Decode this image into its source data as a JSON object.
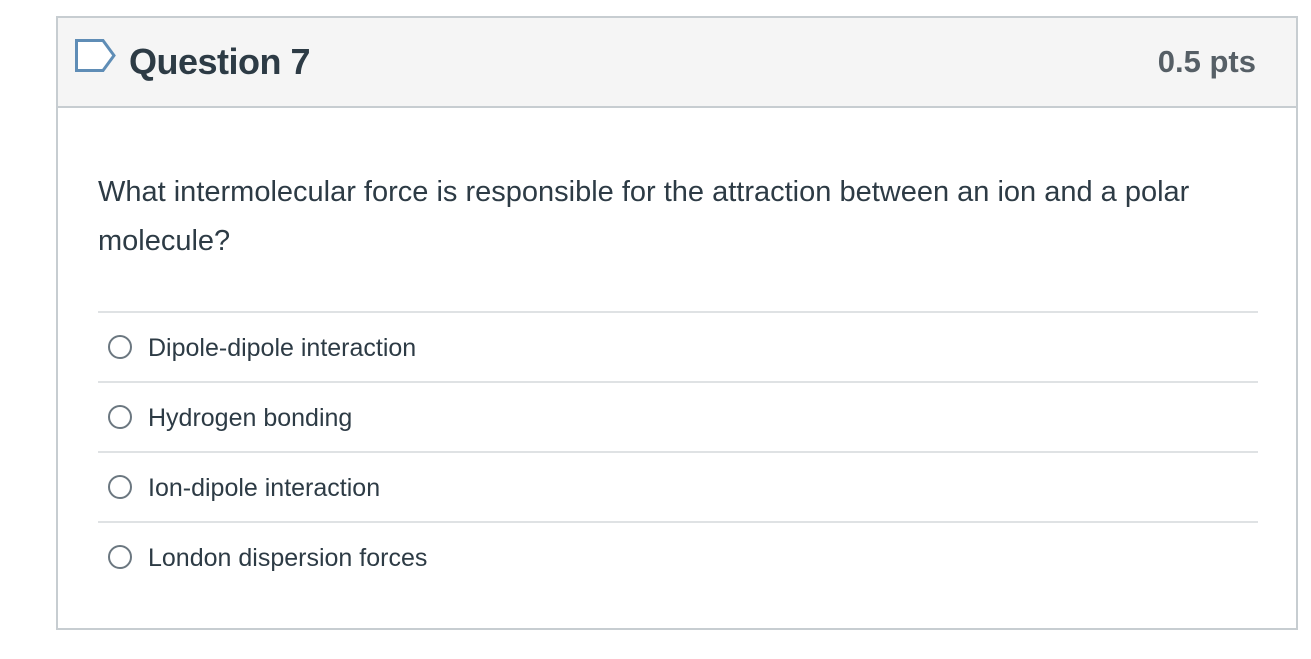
{
  "question": {
    "title": "Question 7",
    "points": "0.5 pts",
    "flag_icon": "flag-outline-icon",
    "text": "What intermolecular force is responsible for the attraction between an ion and a polar molecule?",
    "answers": [
      {
        "label": "Dipole-dipole interaction",
        "selected": false
      },
      {
        "label": "Hydrogen bonding",
        "selected": false
      },
      {
        "label": "Ion-dipole interaction",
        "selected": false
      },
      {
        "label": "London dispersion forces",
        "selected": false
      }
    ]
  },
  "colors": {
    "header_bg": "#f5f5f5",
    "border": "#c7cdd1",
    "text": "#2d3b45",
    "points_text": "#565f66",
    "flag_stroke": "#5f8db6"
  }
}
